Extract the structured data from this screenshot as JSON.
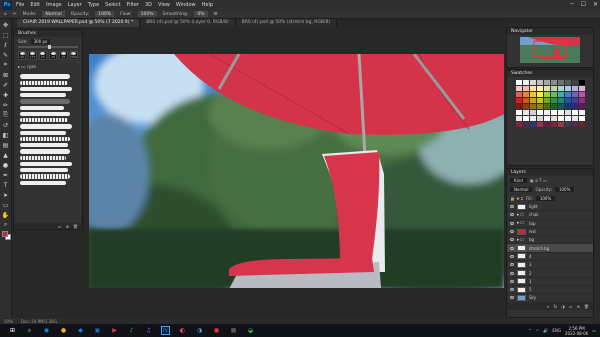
{
  "menu": {
    "logo": "Ps",
    "items": [
      "File",
      "Edit",
      "Image",
      "Layer",
      "Type",
      "Select",
      "Filter",
      "3D",
      "View",
      "Window",
      "Help"
    ]
  },
  "options": {
    "mode_label": "Mode:",
    "mode_value": "Normal",
    "opacity_label": "Opacity:",
    "opacity_value": "100%",
    "flow_label": "Flow:",
    "flow_value": "100%",
    "smoothing_label": "Smoothing:",
    "smoothing_value": "0%"
  },
  "tabs": [
    {
      "label": "CHAIR 2019 WALLPAPER.psd @ 50% (7 2020.9) *",
      "active": true
    },
    {
      "label": "BRS (4).psd @ 50% (Layer 0, RGB/8)",
      "active": false
    },
    {
      "label": "BRS (4).psd @ 50% (stretch bg, RGB/8)",
      "active": false
    }
  ],
  "tools": [
    "move-icon",
    "marquee-icon",
    "lasso-icon",
    "quick-select-icon",
    "crop-icon",
    "frame-icon",
    "eyedropper-icon",
    "healing-icon",
    "brush-icon",
    "clone-icon",
    "history-brush-icon",
    "eraser-icon",
    "gradient-icon",
    "blur-icon",
    "dodge-icon",
    "pen-icon",
    "type-icon",
    "path-select-icon",
    "shape-icon",
    "hand-icon",
    "zoom-icon"
  ],
  "tool_glyphs": [
    "✥",
    "⬚",
    "ℓ",
    "✎",
    "⌗",
    "⊠",
    "✐",
    "✚",
    "✏",
    "⎘",
    "↺",
    "◧",
    "▤",
    "▲",
    "●",
    "✒",
    "T",
    "➤",
    "▭",
    "✋",
    "⌕"
  ],
  "colors": {
    "foreground": "#c2273b",
    "background": "#ffffff",
    "accent": "#31a8ff"
  },
  "brushes": {
    "title": "Brushes",
    "size_label": "Size:",
    "size_value": "300 px",
    "presets": [
      "25",
      "175",
      "25",
      "36",
      "25",
      "300"
    ],
    "folder_label": "ryan",
    "stroke_count": 18
  },
  "navigator": {
    "title": "Navigator"
  },
  "swatches": {
    "title": "Swatches",
    "colors": [
      "#ffffff",
      "#f2f2f2",
      "#d9d9d9",
      "#bfbfbf",
      "#a6a6a6",
      "#8c8c8c",
      "#737373",
      "#595959",
      "#404040",
      "#000000",
      "#f4c7c3",
      "#f8b8a0",
      "#fbe3a0",
      "#fdf2a8",
      "#d6e9a8",
      "#b6dba8",
      "#a8dbd0",
      "#a8c8e8",
      "#b8b0e0",
      "#e0b0d8",
      "#e06060",
      "#f08040",
      "#f0c040",
      "#f0f040",
      "#a0d040",
      "#60c060",
      "#40b0a0",
      "#4080d0",
      "#7060c0",
      "#c050b0",
      "#c02828",
      "#d05818",
      "#d0a018",
      "#c8c818",
      "#70a820",
      "#289838",
      "#208878",
      "#1858a8",
      "#4838a0",
      "#982888",
      "#801818",
      "#904010",
      "#907010",
      "#888810",
      "#487018",
      "#186828",
      "#185850",
      "#103878",
      "#302870",
      "#601860",
      "#ffffff",
      "#e8e8e8",
      "#d0d0d0",
      "#ffffff",
      "#f0f0f0",
      "#ffffff",
      "#f8f8f8",
      "#e0e0e0",
      "#ffffff",
      "#f0f0f0",
      "#e8e8e8",
      "#ffffff",
      "#f0f0f0",
      "#d8d8d8",
      "#ffffff",
      "#e0e0e0",
      "#ffffff",
      "#f8f8f8",
      "#e8e8e8",
      "#ffffff",
      "#8a2040",
      "#4a2858",
      "#283870",
      "#a03050",
      "#602048",
      "#7a2838",
      "#9a3848",
      "#3a3a4a",
      "#5a2a4a",
      "#702030"
    ]
  },
  "layers": {
    "title": "Layers",
    "kind_label": "Kind",
    "blend_value": "Normal",
    "opacity_label": "Opacity:",
    "opacity_value": "100%",
    "fill_label": "Fill:",
    "fill_value": "100%",
    "items": [
      {
        "name": "light",
        "type": "layer",
        "selected": false
      },
      {
        "name": "chair",
        "type": "folder",
        "selected": false
      },
      {
        "name": "top",
        "type": "folder",
        "selected": false
      },
      {
        "name": "red",
        "type": "layer",
        "selected": false
      },
      {
        "name": "bg",
        "type": "folder",
        "selected": false
      },
      {
        "name": "stretch bg",
        "type": "layer",
        "selected": true
      },
      {
        "name": "4",
        "type": "layer",
        "selected": false
      },
      {
        "name": "3",
        "type": "layer",
        "selected": false
      },
      {
        "name": "2",
        "type": "layer",
        "selected": false
      },
      {
        "name": "1",
        "type": "layer",
        "selected": false
      },
      {
        "name": "5",
        "type": "layer",
        "selected": false
      },
      {
        "name": "Sky",
        "type": "layer",
        "selected": false
      }
    ]
  },
  "status": {
    "zoom": "50%",
    "doc": "Doc: 24.9M/1.38G"
  },
  "taskbar": {
    "apps": [
      "⊞",
      "⌕",
      "◉",
      "●",
      "◆",
      "▣",
      "▶",
      "♪",
      "♫",
      "Ps",
      "◐",
      "◑",
      "●",
      "■",
      "◒"
    ],
    "app_colors": [
      "#ffffff",
      "#cccccc",
      "#2b95e9",
      "#f2b01e",
      "#0a84ff",
      "#1b6ec2",
      "#e03c31",
      "#1db954",
      "#7d5fff",
      "#31a8ff",
      "#ff4f6a",
      "#4aa3df",
      "#d33",
      "#555",
      "#2ec866"
    ],
    "lang": "ENG",
    "time": "2:56 PM",
    "date": "2022-08-06"
  }
}
